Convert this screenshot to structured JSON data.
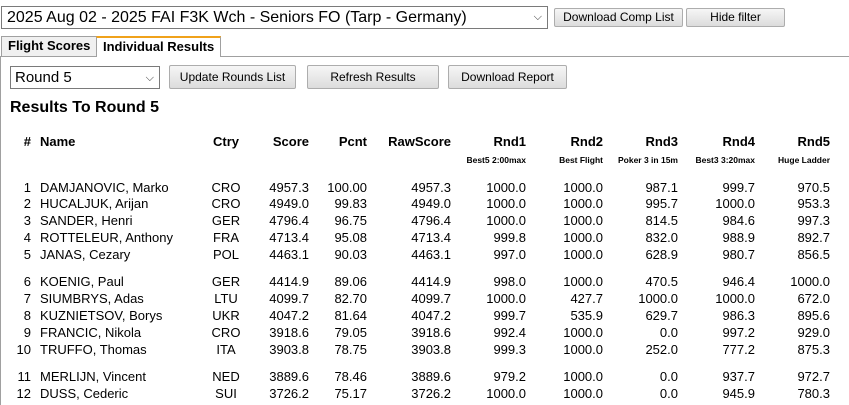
{
  "competition_select": {
    "value": "2025 Aug 02 - 2025 FAI F3K Wch - Seniors FO (Tarp - Germany)"
  },
  "top_buttons": {
    "download_comp_list": "Download Comp List",
    "hide_filter": "Hide filter"
  },
  "tabs": [
    {
      "label": "Flight Scores",
      "active": false
    },
    {
      "label": "Individual Results",
      "active": true
    }
  ],
  "round_select": {
    "value": "Round 5"
  },
  "buttons": {
    "update_rounds": "Update Rounds List",
    "refresh": "Refresh Results",
    "download_report": "Download Report"
  },
  "results_title": "Results To Round 5",
  "columns": {
    "num": "#",
    "name": "Name",
    "ctry": "Ctry",
    "score": "Score",
    "pcnt": "Pcnt",
    "raw": "RawScore",
    "rnd1": "Rnd1",
    "rnd2": "Rnd2",
    "rnd3": "Rnd3",
    "rnd4": "Rnd4",
    "rnd5": "Rnd5"
  },
  "round_tasks": {
    "rnd1": "Best5 2:00max",
    "rnd2": "Best Flight",
    "rnd3": "Poker 3 in 15m",
    "rnd4": "Best3 3:20max",
    "rnd5": "Huge Ladder"
  },
  "rows": [
    {
      "num": "1",
      "name": "DAMJANOVIC, Marko",
      "ctry": "CRO",
      "score": "4957.3",
      "pcnt": "100.00",
      "raw": "4957.3",
      "r1": "1000.0",
      "r2": "1000.0",
      "r3": "987.1",
      "r4": "999.7",
      "r5": "970.5"
    },
    {
      "num": "2",
      "name": "HUCALJUK, Arijan",
      "ctry": "CRO",
      "score": "4949.0",
      "pcnt": "99.83",
      "raw": "4949.0",
      "r1": "1000.0",
      "r2": "1000.0",
      "r3": "995.7",
      "r4": "1000.0",
      "r5": "953.3"
    },
    {
      "num": "3",
      "name": "SANDER, Henri",
      "ctry": "GER",
      "score": "4796.4",
      "pcnt": "96.75",
      "raw": "4796.4",
      "r1": "1000.0",
      "r2": "1000.0",
      "r3": "814.5",
      "r4": "984.6",
      "r5": "997.3"
    },
    {
      "num": "4",
      "name": "ROTTELEUR, Anthony",
      "ctry": "FRA",
      "score": "4713.4",
      "pcnt": "95.08",
      "raw": "4713.4",
      "r1": "999.8",
      "r2": "1000.0",
      "r3": "832.0",
      "r4": "988.9",
      "r5": "892.7"
    },
    {
      "num": "5",
      "name": "JANAS, Cezary",
      "ctry": "POL",
      "score": "4463.1",
      "pcnt": "90.03",
      "raw": "4463.1",
      "r1": "997.0",
      "r2": "1000.0",
      "r3": "628.9",
      "r4": "980.7",
      "r5": "856.5"
    },
    {
      "num": "6",
      "name": "KOENIG, Paul",
      "ctry": "GER",
      "score": "4414.9",
      "pcnt": "89.06",
      "raw": "4414.9",
      "r1": "998.0",
      "r2": "1000.0",
      "r3": "470.5",
      "r4": "946.4",
      "r5": "1000.0"
    },
    {
      "num": "7",
      "name": "SIUMBRYS, Adas",
      "ctry": "LTU",
      "score": "4099.7",
      "pcnt": "82.70",
      "raw": "4099.7",
      "r1": "1000.0",
      "r2": "427.7",
      "r3": "1000.0",
      "r4": "1000.0",
      "r5": "672.0"
    },
    {
      "num": "8",
      "name": "KUZNIETSOV, Borys",
      "ctry": "UKR",
      "score": "4047.2",
      "pcnt": "81.64",
      "raw": "4047.2",
      "r1": "999.7",
      "r2": "535.9",
      "r3": "629.7",
      "r4": "986.3",
      "r5": "895.6"
    },
    {
      "num": "9",
      "name": "FRANCIC, Nikola",
      "ctry": "CRO",
      "score": "3918.6",
      "pcnt": "79.05",
      "raw": "3918.6",
      "r1": "992.4",
      "r2": "1000.0",
      "r3": "0.0",
      "r4": "997.2",
      "r5": "929.0"
    },
    {
      "num": "10",
      "name": "TRUFFO, Thomas",
      "ctry": "ITA",
      "score": "3903.8",
      "pcnt": "78.75",
      "raw": "3903.8",
      "r1": "999.3",
      "r2": "1000.0",
      "r3": "252.0",
      "r4": "777.2",
      "r5": "875.3"
    },
    {
      "num": "11",
      "name": "MERLIJN, Vincent",
      "ctry": "NED",
      "score": "3889.6",
      "pcnt": "78.46",
      "raw": "3889.6",
      "r1": "979.2",
      "r2": "1000.0",
      "r3": "0.0",
      "r4": "937.7",
      "r5": "972.7"
    },
    {
      "num": "12",
      "name": "DUSS, Cederic",
      "ctry": "SUI",
      "score": "3726.2",
      "pcnt": "75.17",
      "raw": "3726.2",
      "r1": "1000.0",
      "r2": "1000.0",
      "r3": "0.0",
      "r4": "945.9",
      "r5": "780.3"
    }
  ]
}
